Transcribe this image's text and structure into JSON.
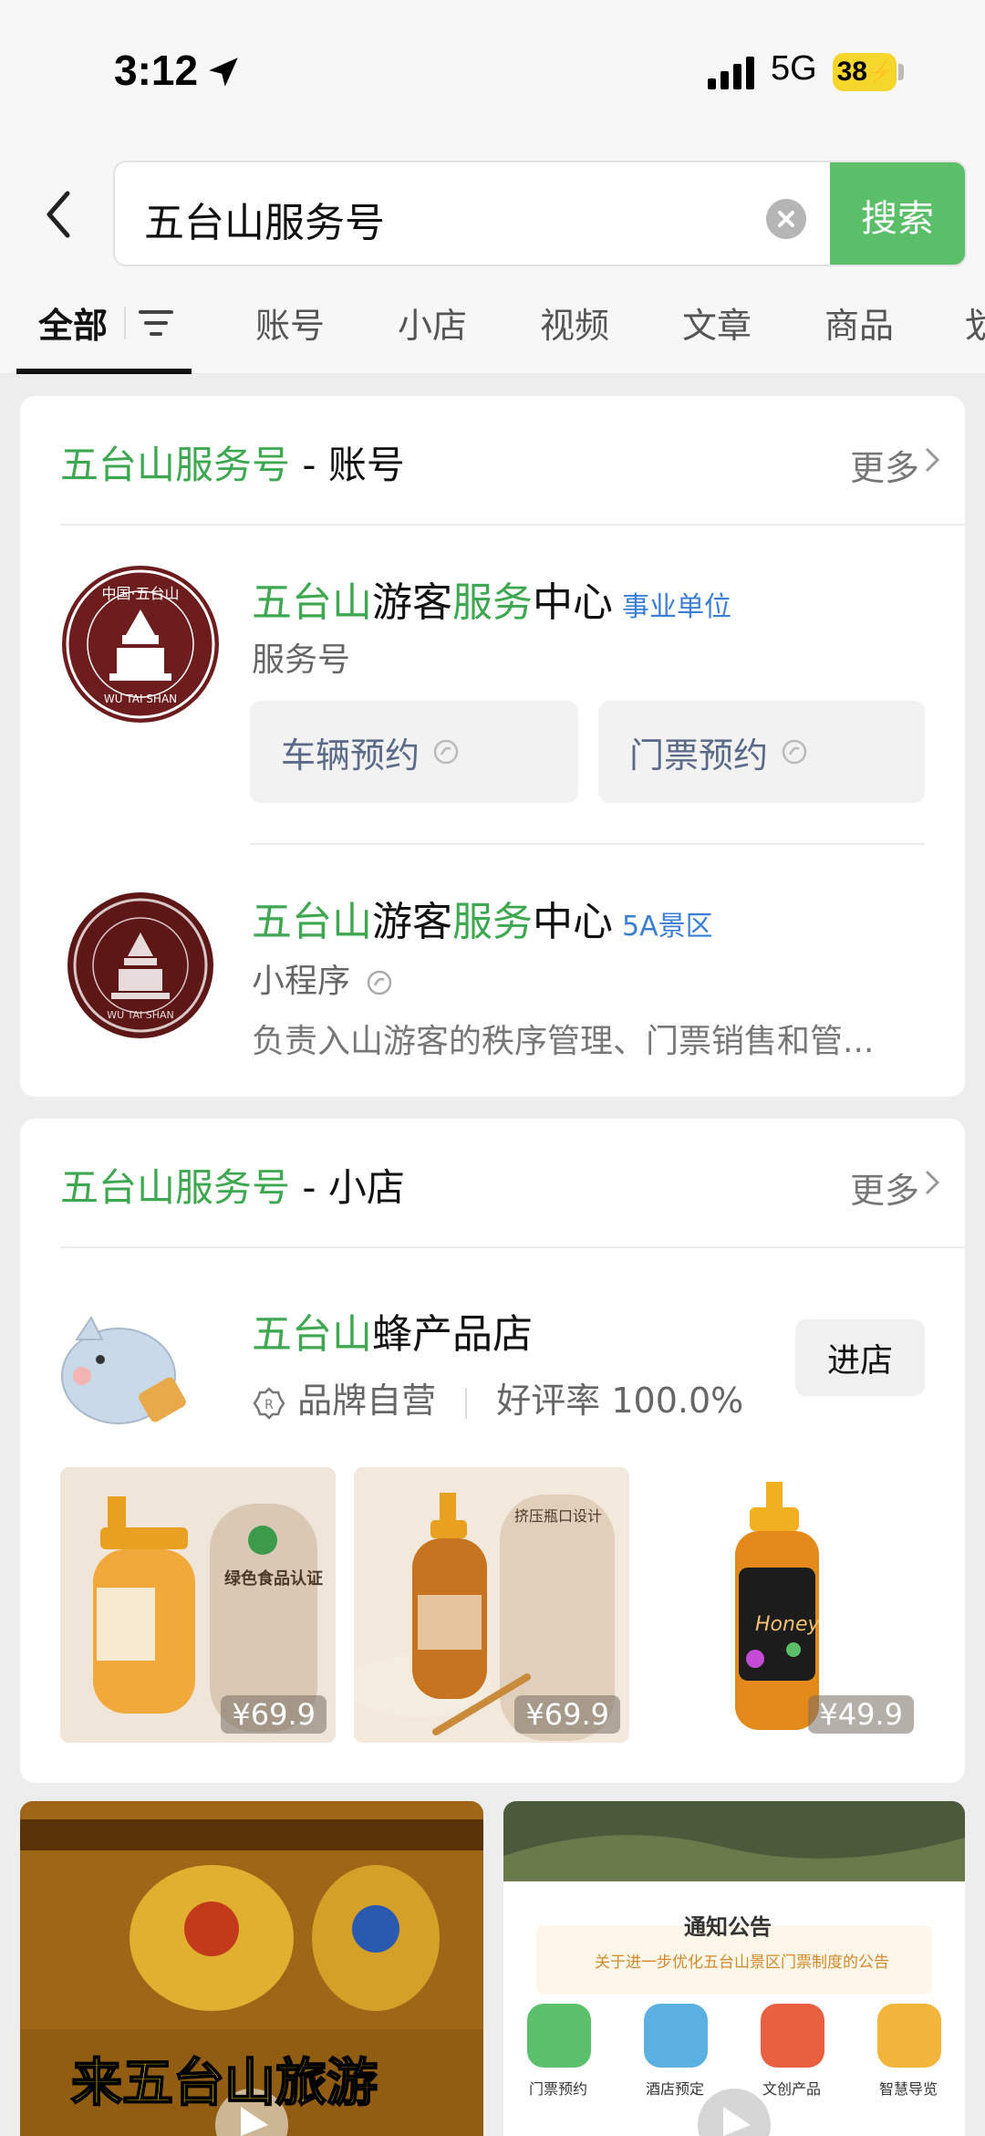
{
  "status_bar": {
    "time": "3:12",
    "network": "5G",
    "battery": "38"
  },
  "search": {
    "query": "五台山服务号",
    "button_label": "搜索"
  },
  "tabs": [
    {
      "label": "全部",
      "active": true
    },
    {
      "label": "账号"
    },
    {
      "label": "小店"
    },
    {
      "label": "视频"
    },
    {
      "label": "文章"
    },
    {
      "label": "商品"
    },
    {
      "label": "划"
    }
  ],
  "accounts_section": {
    "title_highlight": "五台山服务号",
    "title_suffix": " - 账号",
    "more_label": "更多",
    "items": [
      {
        "name_parts": [
          "五台山",
          "游客",
          "服务",
          "中心"
        ],
        "badge": "事业单位",
        "type": "服务号",
        "actions": [
          "车辆预约",
          "门票预约"
        ]
      },
      {
        "name_parts": [
          "五台山",
          "游客",
          "服务",
          "中心"
        ],
        "badge": "5A景区",
        "type": "小程序",
        "description": "负责入山游客的秩序管理、门票销售和管..."
      }
    ],
    "logo_text": {
      "top": "中国·五台山",
      "bottom": "WU TAI SHAN"
    }
  },
  "shop_section": {
    "title_highlight": "五台山服务号",
    "title_suffix": " - 小店",
    "more_label": "更多",
    "shop": {
      "name_highlight": "五台山",
      "name_rest": "蜂产品店",
      "tag": "品牌自营",
      "rating": "好评率 100.0%",
      "enter_label": "进店"
    },
    "products": [
      {
        "price": "¥69.9",
        "label": "绿色食品认证"
      },
      {
        "price": "¥69.9",
        "label": "挤压瓶口设计"
      },
      {
        "price": "¥49.9",
        "label": "Honey"
      }
    ]
  },
  "videos": [
    {
      "caption": "来五台山旅游"
    },
    {
      "notice_title": "通知公告",
      "notice_text": "关于进一步优化五台山景区门票制度的公告",
      "shortcuts": [
        "门票预约",
        "酒店预定",
        "文创产品",
        "智慧导览"
      ]
    }
  ],
  "colors": {
    "accent": "#3da850",
    "search_button": "#5bbf6a",
    "badge_blue": "#3a7ed6"
  }
}
